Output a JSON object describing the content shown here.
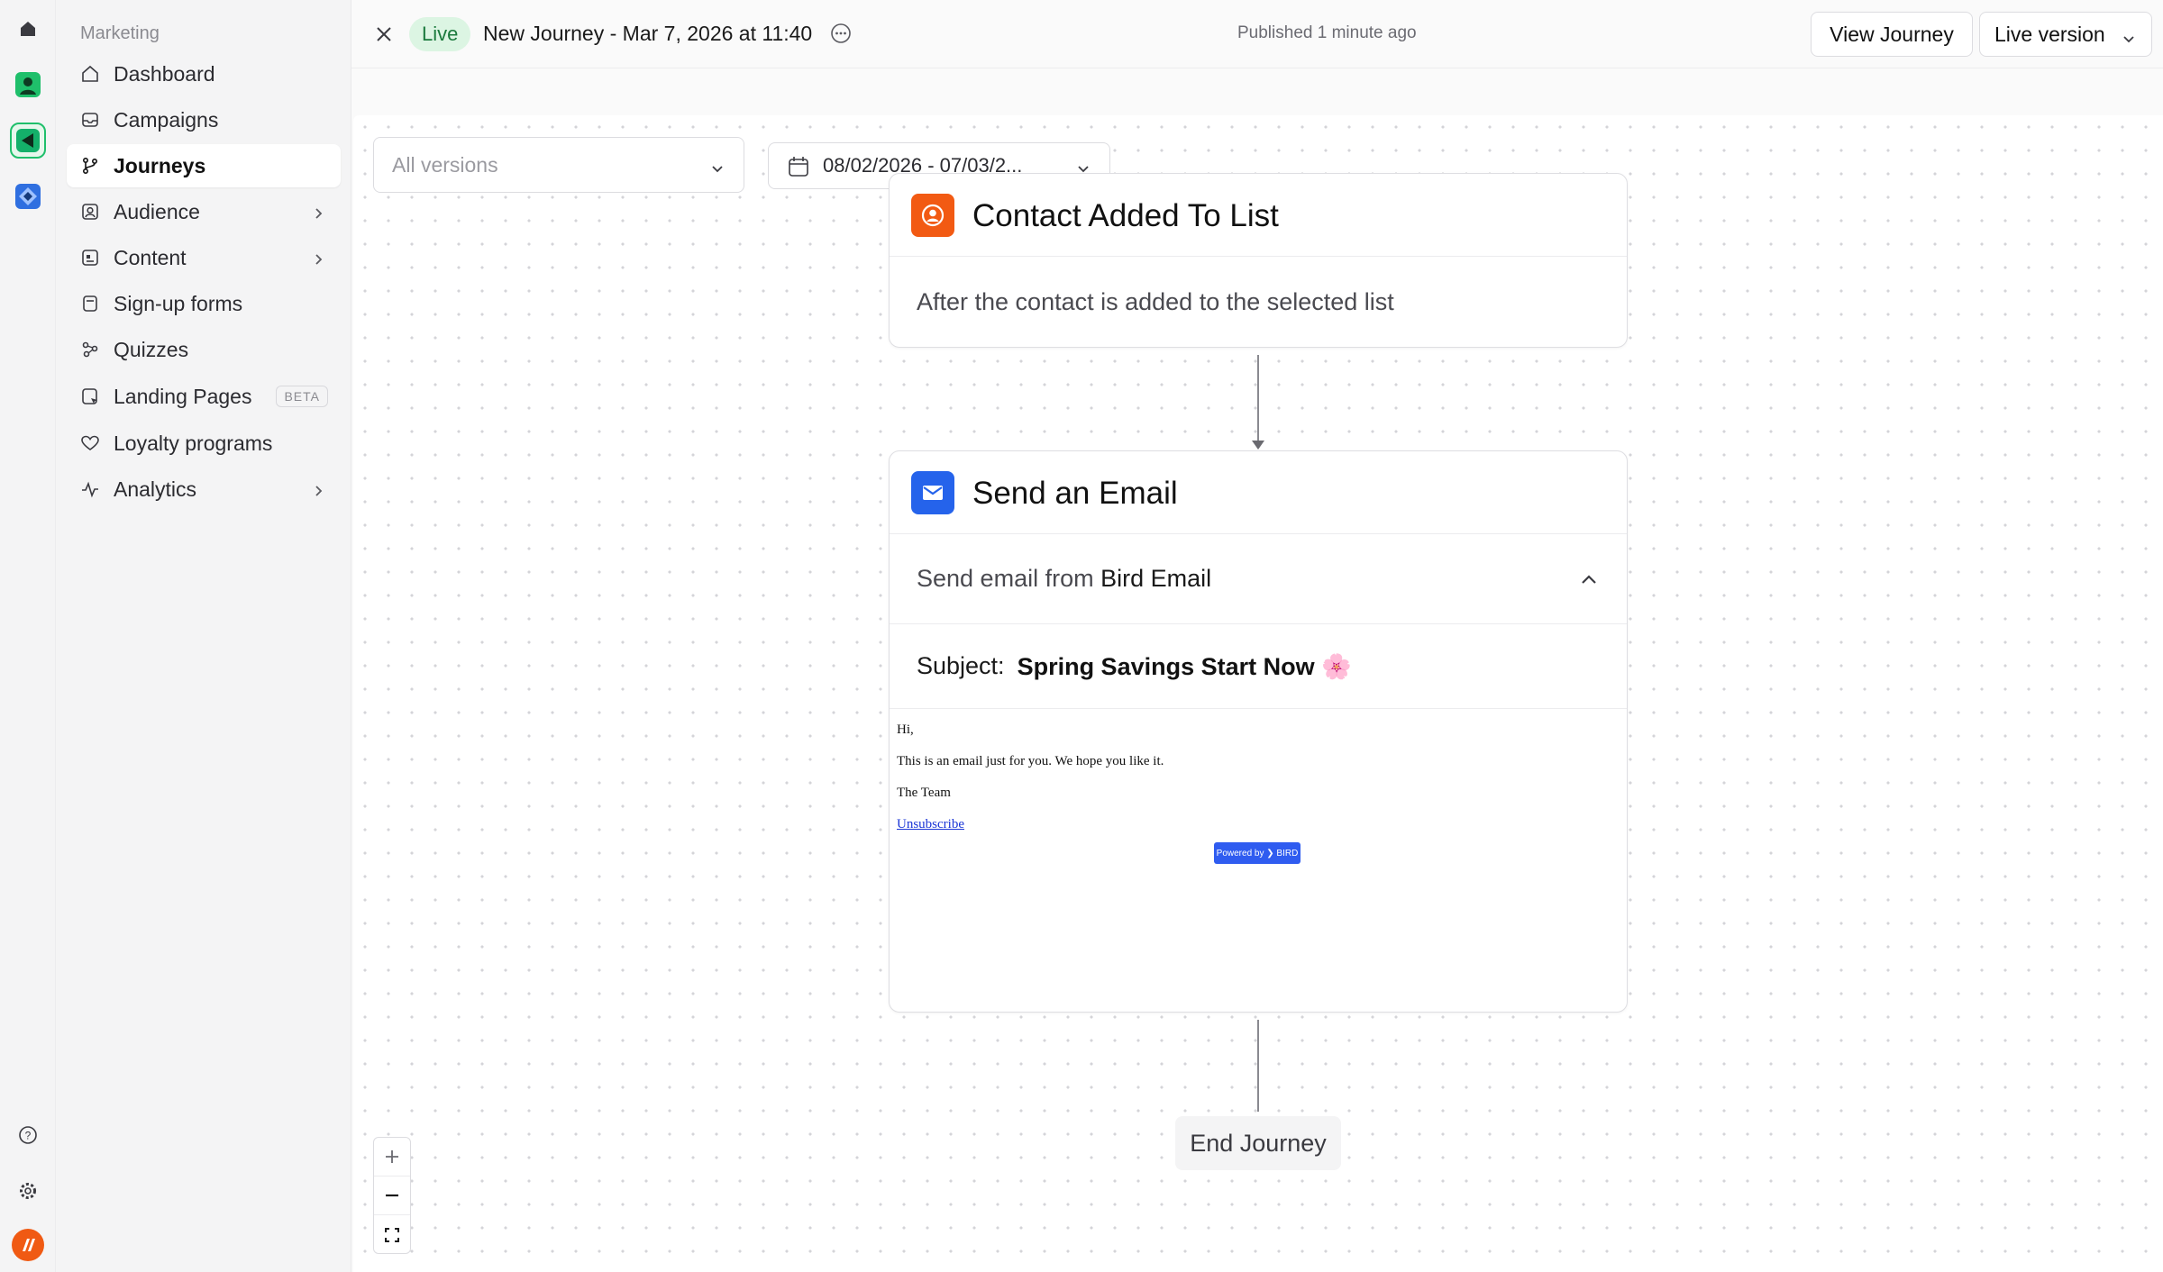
{
  "sidebar": {
    "section": "Marketing",
    "items": [
      {
        "label": "Dashboard"
      },
      {
        "label": "Campaigns"
      },
      {
        "label": "Journeys"
      },
      {
        "label": "Audience"
      },
      {
        "label": "Content"
      },
      {
        "label": "Sign-up forms"
      },
      {
        "label": "Quizzes"
      },
      {
        "label": "Landing Pages",
        "badge": "BETA"
      },
      {
        "label": "Loyalty programs"
      },
      {
        "label": "Analytics"
      }
    ]
  },
  "header": {
    "status": "Live",
    "title": "New Journey - Mar 7, 2026 at 11:40",
    "published": "Published 1 minute ago",
    "view_button": "View Journey",
    "version_button": "Live version"
  },
  "canvas": {
    "versions_placeholder": "All versions",
    "date_range": "08/02/2026 - 07/03/2...",
    "trigger": {
      "title": "Contact Added To List",
      "description": "After the contact is added to the selected list"
    },
    "email_step": {
      "title": "Send an Email",
      "from_prefix": "Send email from",
      "from_name": "Bird Email",
      "subject_label": "Subject:",
      "subject_value": "Spring Savings Start Now 🌸",
      "body": {
        "greeting": "Hi,",
        "line": "This is an email just for you. We hope you like it.",
        "signoff": "The Team",
        "unsubscribe": "Unsubscribe",
        "powered": "Powered by ❯ BIRD"
      }
    },
    "end": "End Journey"
  },
  "colors": {
    "accent_live": "#dcf5e3",
    "trigger_icon": "#f25a13",
    "email_icon": "#2563eb"
  }
}
